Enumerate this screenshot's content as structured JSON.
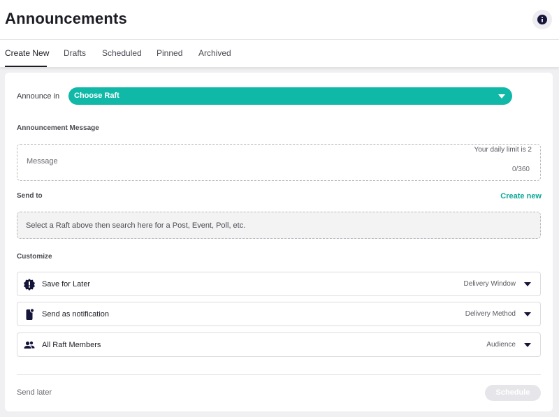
{
  "header": {
    "title": "Announcements",
    "info_icon": "info-icon"
  },
  "tabs": [
    {
      "label": "Create New",
      "active": true
    },
    {
      "label": "Drafts",
      "active": false
    },
    {
      "label": "Scheduled",
      "active": false
    },
    {
      "label": "Pinned",
      "active": false
    },
    {
      "label": "Archived",
      "active": false
    }
  ],
  "form": {
    "announce_in_label": "Announce in",
    "raft_select": {
      "selected": "Choose Raft"
    },
    "message_section_label": "Announcement Message",
    "message": {
      "placeholder": "Message",
      "daily_limit": "Your daily limit is 2",
      "char_count": "0/360"
    },
    "send_to_label": "Send to",
    "create_new_label": "Create new",
    "search_placeholder": "Select a Raft above then search here for a Post, Event, Poll, etc.",
    "customize_label": "Customize",
    "options": [
      {
        "label": "Save for Later",
        "meta": "Delivery Window",
        "icon": "clock-badge-icon"
      },
      {
        "label": "Send as notification",
        "meta": "Delivery Method",
        "icon": "phone-notification-icon"
      },
      {
        "label": "All Raft Members",
        "meta": "Audience",
        "icon": "people-icon"
      }
    ]
  },
  "footer": {
    "send_later_label": "Send later",
    "schedule_label": "Schedule"
  },
  "colors": {
    "accent": "#10b8a8",
    "accent_text": "#0aa898",
    "icon_dark": "#15153a",
    "disabled_button": "#e6e6ea"
  }
}
